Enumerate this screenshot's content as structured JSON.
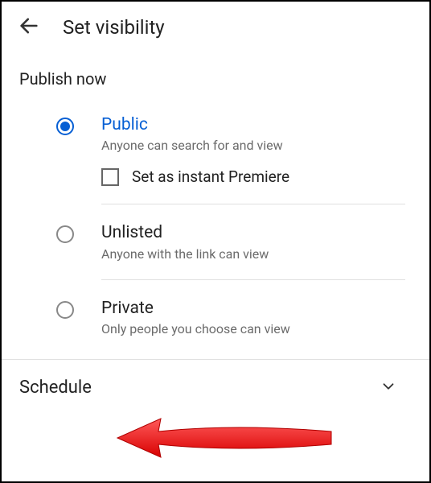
{
  "header": {
    "title": "Set visibility"
  },
  "publish": {
    "section_label": "Publish now",
    "options": {
      "public": {
        "title": "Public",
        "desc": "Anyone can search for and view",
        "premiere_label": "Set as instant Premiere"
      },
      "unlisted": {
        "title": "Unlisted",
        "desc": "Anyone with the link can view"
      },
      "private": {
        "title": "Private",
        "desc": "Only people you choose can view"
      }
    }
  },
  "schedule": {
    "label": "Schedule"
  },
  "colors": {
    "accent": "#065fd4",
    "annotation": "#ff0000"
  }
}
